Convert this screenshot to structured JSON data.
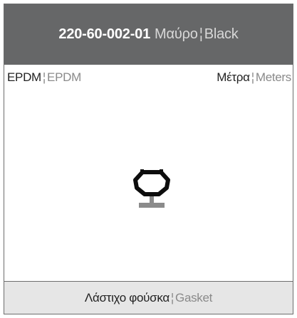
{
  "header": {
    "code": "220-60-002-01",
    "color_gr": "Μαύρο",
    "color_en": "Black",
    "separator": "¦"
  },
  "info": {
    "material_gr": "EPDM",
    "material_en": "EPDM",
    "unit_gr": "Μέτρα",
    "unit_en": "Meters",
    "separator": "¦"
  },
  "footer": {
    "type_gr": "Λάστιχο φούσκα",
    "type_en": "Gasket",
    "separator": "¦"
  },
  "drawing": {
    "icon": "gasket-profile-icon",
    "colors": {
      "outline": "#0d0d0d",
      "base": "#8b8b8b"
    }
  },
  "colors": {
    "header_bg": "#666768",
    "footer_bg": "#e6e6e6",
    "border": "#6d6d6d"
  }
}
